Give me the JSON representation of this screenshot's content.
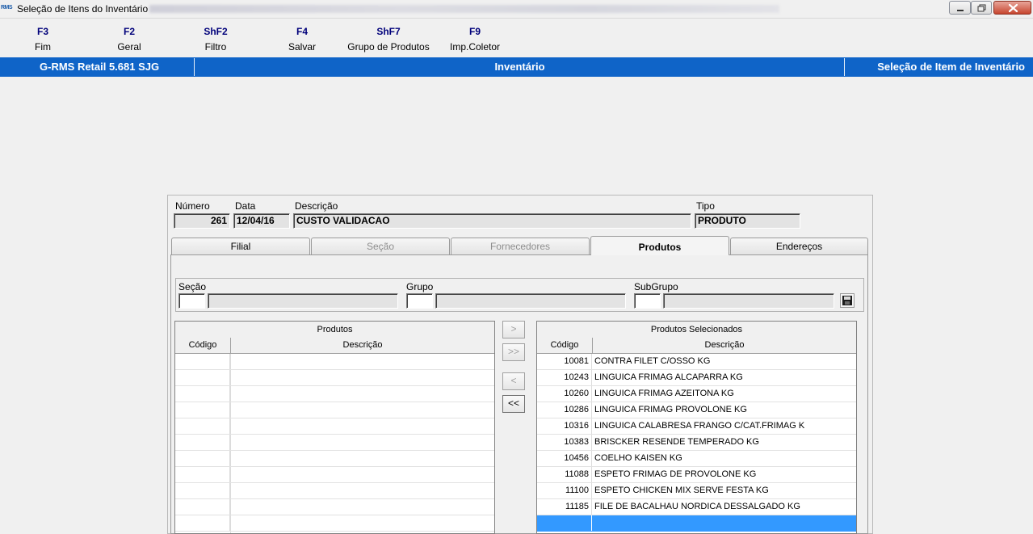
{
  "window": {
    "title": "Seleção de Itens do Inventário",
    "icon_text": "RMS"
  },
  "toolbar": [
    {
      "key": "F3",
      "label": "Fim"
    },
    {
      "key": "F2",
      "label": "Geral"
    },
    {
      "key": "ShF2",
      "label": "Filtro"
    },
    {
      "key": "F4",
      "label": "Salvar"
    },
    {
      "key": "ShF7",
      "label": "Grupo de Produtos"
    },
    {
      "key": "F9",
      "label": "Imp.Coletor"
    }
  ],
  "header": {
    "app": "G-RMS Retail 5.681 SJG",
    "module": "Inventário",
    "screen": "Seleção de Item de Inventário"
  },
  "form": {
    "numero_label": "Número",
    "numero": "261",
    "data_label": "Data",
    "data": "12/04/16",
    "descricao_label": "Descrição",
    "descricao": "CUSTO VALIDACAO",
    "tipo_label": "Tipo",
    "tipo": "PRODUTO"
  },
  "tabs": [
    {
      "label": "Filial",
      "state": "normal"
    },
    {
      "label": "Seção",
      "state": "disabled"
    },
    {
      "label": "Fornecedores",
      "state": "disabled"
    },
    {
      "label": "Produtos",
      "state": "active"
    },
    {
      "label": "Endereços",
      "state": "normal"
    }
  ],
  "filters": {
    "secao_label": "Seção",
    "grupo_label": "Grupo",
    "subgrupo_label": "SubGrupo"
  },
  "left_grid": {
    "title": "Produtos",
    "col_code": "Código",
    "col_desc": "Descrição"
  },
  "right_grid": {
    "title": "Produtos Selecionados",
    "col_code": "Código",
    "col_desc": "Descrição",
    "rows": [
      {
        "code": "10081",
        "desc": "CONTRA FILET C/OSSO KG"
      },
      {
        "code": "10243",
        "desc": "LINGUICA FRIMAG ALCAPARRA KG"
      },
      {
        "code": "10260",
        "desc": "LINGUICA FRIMAG AZEITONA KG"
      },
      {
        "code": "10286",
        "desc": "LINGUICA FRIMAG PROVOLONE KG"
      },
      {
        "code": "10316",
        "desc": "LINGUICA CALABRESA FRANGO C/CAT.FRIMAG K"
      },
      {
        "code": "10383",
        "desc": "BRISCKER RESENDE TEMPERADO KG"
      },
      {
        "code": "10456",
        "desc": "COELHO KAISEN KG"
      },
      {
        "code": "11088",
        "desc": "ESPETO FRIMAG DE PROVOLONE KG"
      },
      {
        "code": "11100",
        "desc": "ESPETO CHICKEN MIX SERVE FESTA KG"
      },
      {
        "code": "11185",
        "desc": "FILE DE BACALHAU NORDICA DESSALGADO KG"
      }
    ]
  },
  "transfer_buttons": [
    ">",
    ">>",
    "<",
    "<<"
  ],
  "colors": {
    "header_bg": "#0f64c8",
    "selection": "#3399ff",
    "fkey": "#00007a"
  }
}
